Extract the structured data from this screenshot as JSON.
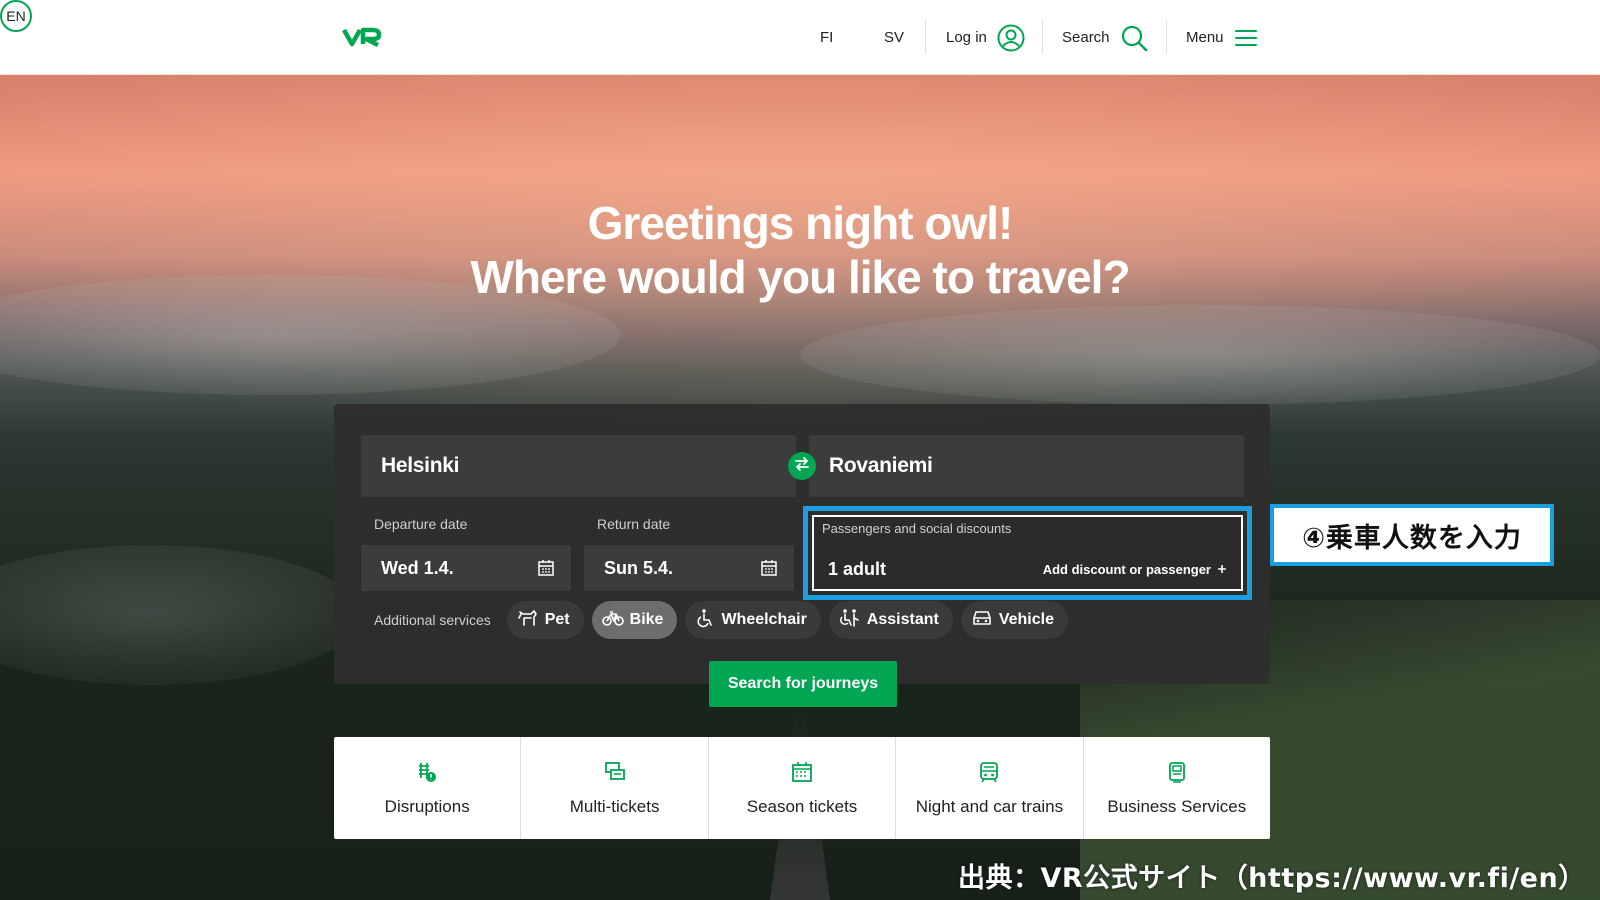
{
  "header": {
    "logo": "VR",
    "languages": [
      "FI",
      "EN",
      "SV"
    ],
    "active_language": "EN",
    "login_label": "Log in",
    "search_label": "Search",
    "menu_label": "Menu"
  },
  "hero": {
    "greeting": "Greetings night owl!",
    "question": "Where would you like to travel?"
  },
  "journey_form": {
    "from": "Helsinki",
    "to": "Rovaniemi",
    "departure_label": "Departure date",
    "departure_value": "Wed 1.4.",
    "return_label": "Return date",
    "return_value": "Sun 5.4.",
    "passengers_label": "Passengers and social discounts",
    "passengers_value": "1 adult",
    "add_discount_label": "Add discount or passenger",
    "additional_services_label": "Additional services",
    "services": [
      {
        "label": "Pet",
        "icon": "pet-icon",
        "active": false
      },
      {
        "label": "Bike",
        "icon": "bike-icon",
        "active": true
      },
      {
        "label": "Wheelchair",
        "icon": "wheelchair-icon",
        "active": false
      },
      {
        "label": "Assistant",
        "icon": "assistant-icon",
        "active": false
      },
      {
        "label": "Vehicle",
        "icon": "vehicle-icon",
        "active": false
      }
    ],
    "search_button": "Search for journeys"
  },
  "quick_links": [
    {
      "label": "Disruptions",
      "icon": "disruptions-icon"
    },
    {
      "label": "Multi-tickets",
      "icon": "multi-tickets-icon"
    },
    {
      "label": "Season tickets",
      "icon": "season-tickets-icon"
    },
    {
      "label": "Night and car trains",
      "icon": "train-icon"
    },
    {
      "label": "Business Services",
      "icon": "business-icon"
    }
  ],
  "annotations": {
    "step_callout": "④乗車人数を入力",
    "source": "出典：VR公式サイト（https://www.vr.fi/en）"
  },
  "colors": {
    "brand_green": "#00a651",
    "highlight_blue": "#1aa0e0",
    "panel_bg": "#2e2e2e"
  }
}
